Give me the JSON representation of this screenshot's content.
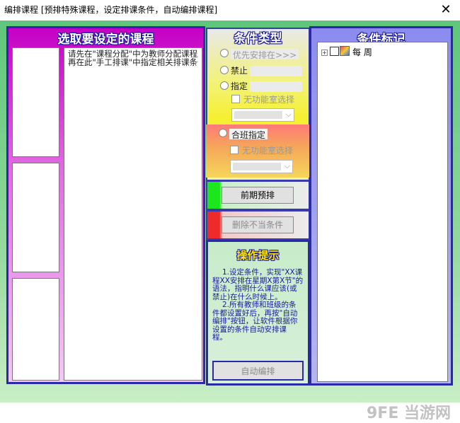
{
  "window": {
    "title": "编排课程 [预排特殊课程，设定排课条件，自动编排课程]",
    "close_glyph": "✕"
  },
  "left": {
    "header": "选取要设定的课程",
    "hint_lines": [
      "请先在\"课程分配\"中为教师分配课程后",
      "再在此\"手工排课\"中指定相关排课条件"
    ]
  },
  "middle": {
    "header": "条件类型",
    "options": {
      "priority": "优先安排在>>>",
      "forbid": "禁止",
      "specify": "指定",
      "merge": "合班指定"
    },
    "no_room_label": "无功能室选择",
    "no_room_label_2": "无功能室选择"
  },
  "buttons": {
    "pre_arrange": "前期预排",
    "delete_bad": "删除不当条件",
    "auto_arrange": "自动编排"
  },
  "tips": {
    "title": "操作提示",
    "lines": [
      "1.设定条件，实现\"XX课",
      "程XX安排在星期X第X节\"的",
      "语法，指明什么课应该(或",
      "禁止)在什么时候上。",
      "2.所有教师和班级的条",
      "件都设置好后，再按\"自动",
      "编排\"按钮，让软件根据你",
      "设置的条件自动安排课",
      "程。"
    ]
  },
  "right": {
    "header": "条件标记",
    "tree_item": "每 周"
  },
  "watermark": "9FE 当游网"
}
